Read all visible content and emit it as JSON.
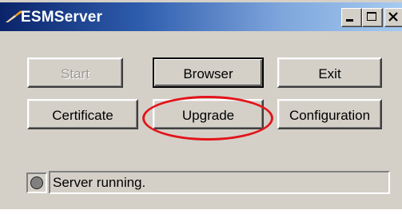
{
  "window": {
    "title": "ESMServer",
    "app_icon": "esm-logo-icon",
    "caption_buttons": [
      "minimize-icon",
      "maximize-icon",
      "close-icon"
    ]
  },
  "buttons": {
    "start": "Start",
    "browser": "Browser",
    "exit": "Exit",
    "certificate": "Certificate",
    "upgrade": "Upgrade",
    "configuration": "Configuration"
  },
  "status": {
    "text": "Server running."
  },
  "colors": {
    "titlebar_start": "#0a246a",
    "titlebar_end": "#a6caf0",
    "highlight": "#e3141a",
    "face": "#d4d0c8"
  }
}
